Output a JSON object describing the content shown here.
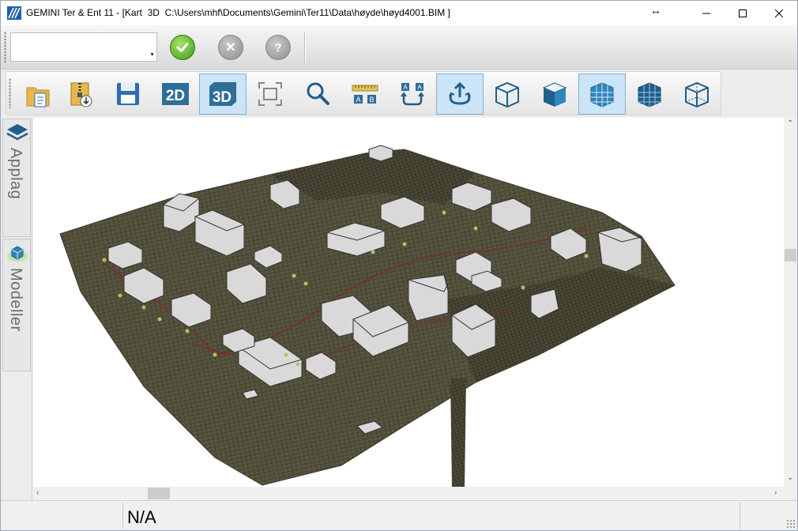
{
  "window": {
    "title": "GEMINI Ter & Ent 11 - [Kart  3D  C:\\Users\\mhf\\Documents\\Gemini\\Ter11\\Data\\høyde\\høyd4001.BIM ]",
    "icon": "gemini-app-icon"
  },
  "commandbar": {
    "combo_value": "",
    "ok_icon": "checkmark-icon",
    "cancel_icon": "x-icon",
    "cancel_glyph": "✕",
    "help_icon": "question-icon",
    "help_glyph": "?"
  },
  "toolbar": {
    "label_2d": "2D",
    "label_3d": "3D",
    "ab_a": "A",
    "ab_b": "B",
    "buttons": [
      {
        "icon": "open-folder-icon",
        "active": false
      },
      {
        "icon": "zip-archive-icon",
        "active": false
      },
      {
        "icon": "save-icon",
        "active": false
      },
      {
        "icon": "2d-view-icon",
        "active": false
      },
      {
        "icon": "3d-view-icon",
        "active": true
      },
      {
        "icon": "zoom-extents-icon",
        "active": false
      },
      {
        "icon": "zoom-icon",
        "active": false
      },
      {
        "icon": "measure-ab-icon",
        "active": false
      },
      {
        "icon": "swap-ab-icon",
        "active": false
      },
      {
        "icon": "rotate-view-icon",
        "active": true
      },
      {
        "icon": "wireframe-cube-icon",
        "active": false
      },
      {
        "icon": "solid-cube-icon",
        "active": false
      },
      {
        "icon": "grid-cube-icon",
        "active": true
      },
      {
        "icon": "grid-cube-dark-icon",
        "active": false
      },
      {
        "icon": "transparent-cube-icon",
        "active": false
      }
    ]
  },
  "dock": {
    "tabs": [
      {
        "label": "Applag",
        "icon": "layers-icon"
      },
      {
        "label": "Modeller",
        "icon": "model-icon"
      }
    ]
  },
  "statusbar": {
    "value": "N/A"
  },
  "colors": {
    "terrain": "#5b5845",
    "terrain_dark": "#2e2c22",
    "building": "#d9d9d9",
    "accent": "#0078d7"
  }
}
